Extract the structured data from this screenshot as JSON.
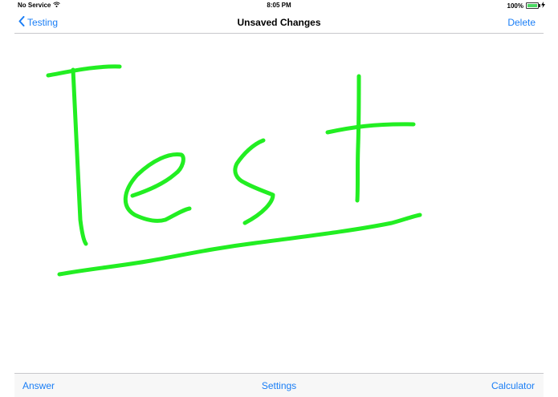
{
  "status_bar": {
    "carrier": "No Service",
    "wifi_icon": "wifi-icon",
    "time": "8:05 PM",
    "battery_percent": "100%",
    "battery_level": 1.0,
    "battery_icon": "battery-icon",
    "charging_icon": "bolt-icon"
  },
  "nav": {
    "back_label": "Testing",
    "back_icon": "chevron-left-icon",
    "title": "Unsaved Changes",
    "delete_label": "Delete"
  },
  "canvas": {
    "ink_color": "#22ee22",
    "stroke_count": 6
  },
  "toolbar": {
    "answer_label": "Answer",
    "settings_label": "Settings",
    "calculator_label": "Calculator"
  },
  "colors": {
    "accent": "#1a7ef6",
    "battery": "#4cd964"
  }
}
